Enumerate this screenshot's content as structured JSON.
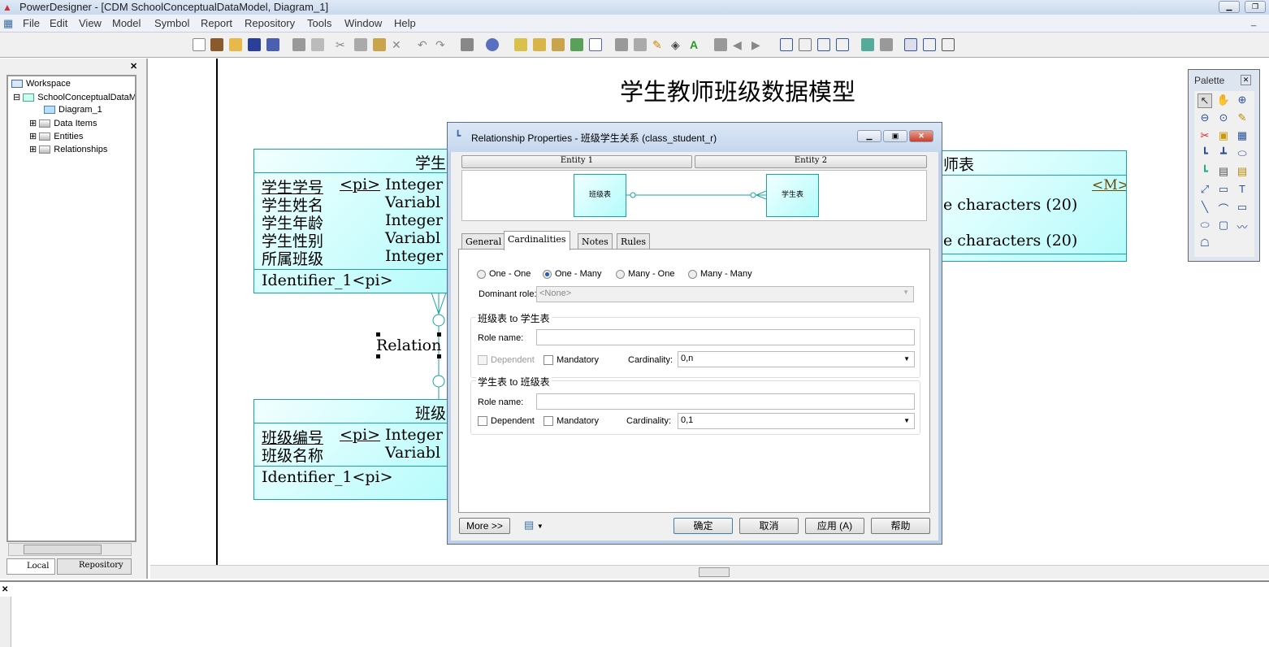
{
  "window": {
    "title": "PowerDesigner - [CDM SchoolConceptualDataModel, Diagram_1]"
  },
  "menu": [
    "File",
    "Edit",
    "View",
    "Model",
    "Symbol",
    "Report",
    "Repository",
    "Tools",
    "Window",
    "Help"
  ],
  "browser": {
    "tree": [
      {
        "label": "Workspace"
      },
      {
        "label": "SchoolConceptualDataModel"
      },
      {
        "label": "Diagram_1"
      },
      {
        "label": "Data Items"
      },
      {
        "label": "Entities"
      },
      {
        "label": "Relationships"
      }
    ],
    "tabs": [
      "Local",
      "Repository"
    ]
  },
  "diagram": {
    "title": "学生教师班级数据模型",
    "student": {
      "name": "学生表",
      "attrs": [
        {
          "name": "学生学号",
          "key": "<pi>",
          "type": "Integer"
        },
        {
          "name": "学生姓名",
          "key": "",
          "type": "Variabl"
        },
        {
          "name": "学生年龄",
          "key": "",
          "type": "Integer"
        },
        {
          "name": "学生性别",
          "key": "",
          "type": "Variabl"
        },
        {
          "name": "所属班级",
          "key": "",
          "type": "Integer"
        }
      ],
      "identifier": "Identifier_1<pi>"
    },
    "class": {
      "name": "班级表",
      "attrs": [
        {
          "name": "班级编号",
          "key": "<pi>",
          "type": "Integer"
        },
        {
          "name": "班级名称",
          "key": "",
          "type": "Variabl"
        }
      ],
      "identifier": "Identifier_1<pi>"
    },
    "teacher": {
      "name": "师表",
      "mandatory": "<M>",
      "types": [
        "e characters (20)",
        "e characters (20)"
      ]
    },
    "relation_label": "Relation"
  },
  "dialog": {
    "title": "Relationship Properties - 班级学生关系 (class_student_r)",
    "entity1_header": "Entity 1",
    "entity2_header": "Entity 2",
    "entity1": "班级表",
    "entity2": "学生表",
    "tabs": [
      "General",
      "Cardinalities",
      "Notes",
      "Rules"
    ],
    "active_tab": "Cardinalities",
    "cardinality_options": [
      "One - One",
      "One - Many",
      "Many - One",
      "Many - Many"
    ],
    "selected_cardinality": "One - Many",
    "dominant_role_label": "Dominant role:",
    "dominant_role_value": "<None>",
    "group1": {
      "title": "班级表 to 学生表",
      "role_label": "Role name:",
      "role_value": "",
      "dependent": "Dependent",
      "mandatory": "Mandatory",
      "card_label": "Cardinality:",
      "card_value": "0,n"
    },
    "group2": {
      "title": "学生表 to 班级表",
      "role_label": "Role name:",
      "role_value": "",
      "dependent": "Dependent",
      "mandatory": "Mandatory",
      "card_label": "Cardinality:",
      "card_value": "0,1"
    },
    "buttons": {
      "more": "More >>",
      "ok": "确定",
      "cancel": "取消",
      "apply": "应用 (A)",
      "help": "帮助"
    }
  },
  "palette": {
    "title": "Palette"
  },
  "colors": {
    "entity_border": "#1aa3a3",
    "entity_fill": "#b3fbfb"
  }
}
